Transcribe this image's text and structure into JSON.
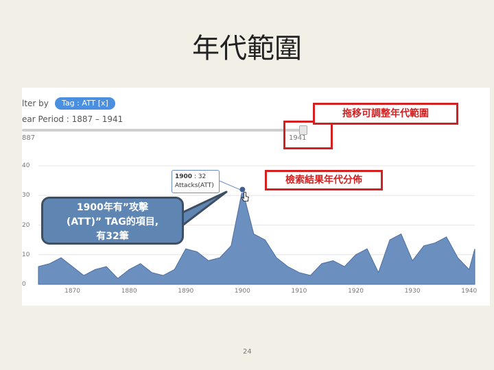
{
  "slide": {
    "title": "年代範圍",
    "page_number": "24"
  },
  "filter": {
    "label": "lter by",
    "tag_pill": "Tag : ATT [x]"
  },
  "period": {
    "label": "ear Period : 1887 – 1941",
    "slider_min": "887",
    "slider_max": "1941"
  },
  "annotations": {
    "drag_adjust": "拖移可調整年代範圍",
    "result_distribution": "檢索結果年代分佈",
    "callout_line1": "1900年有”攻擊",
    "callout_line2": "(ATT)” TAG的項目,",
    "callout_line3": "有32筆"
  },
  "tooltip": {
    "year": "1900",
    "count_suffix": ": 32",
    "series_label": "Attacks(ATT)"
  },
  "colors": {
    "area_fill": "#6b8fbf",
    "area_stroke": "#4d6f9f",
    "highlight": "#d32020",
    "callout_bg": "#5f86b3"
  },
  "chart_data": {
    "type": "area",
    "x": [
      1864,
      1866,
      1868,
      1870,
      1872,
      1874,
      1876,
      1878,
      1880,
      1882,
      1884,
      1886,
      1888,
      1890,
      1892,
      1894,
      1896,
      1898,
      1900,
      1902,
      1904,
      1906,
      1908,
      1910,
      1912,
      1914,
      1916,
      1918,
      1920,
      1922,
      1924,
      1926,
      1928,
      1930,
      1932,
      1934,
      1936,
      1938,
      1940,
      1941
    ],
    "values": [
      6,
      7,
      9,
      6,
      3,
      5,
      6,
      2,
      5,
      7,
      4,
      3,
      5,
      12,
      11,
      8,
      9,
      13,
      32,
      17,
      15,
      9,
      6,
      4,
      3,
      7,
      8,
      6,
      10,
      12,
      4,
      15,
      17,
      8,
      13,
      14,
      16,
      9,
      5,
      12
    ],
    "series": [
      {
        "name": "Attacks(ATT)"
      }
    ],
    "highlight_point": {
      "x": 1900,
      "y": 32
    },
    "y_ticks": [
      "40",
      "30",
      "20",
      "10",
      "0"
    ],
    "x_ticks": [
      "1870",
      "1880",
      "1890",
      "1900",
      "1910",
      "1920",
      "1930",
      "1940"
    ],
    "xlim": [
      1864,
      1941
    ],
    "ylim": [
      0,
      40
    ]
  }
}
